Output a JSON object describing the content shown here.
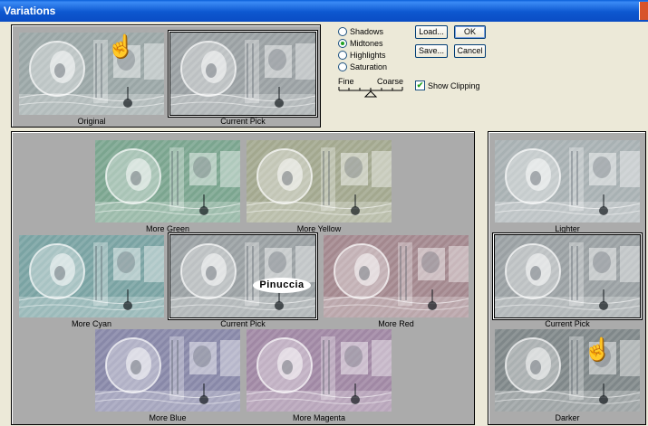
{
  "window": {
    "title": "Variations"
  },
  "tone_options": [
    {
      "label": "Shadows",
      "selected": false
    },
    {
      "label": "Midtones",
      "selected": true
    },
    {
      "label": "Highlights",
      "selected": false
    },
    {
      "label": "Saturation",
      "selected": false
    }
  ],
  "buttons": {
    "load": "Load...",
    "ok": "OK",
    "save": "Save...",
    "cancel": "Cancel"
  },
  "slider": {
    "fine": "Fine",
    "coarse": "Coarse",
    "level": 0.5
  },
  "show_clipping": {
    "label": "Show Clipping",
    "checked": true
  },
  "top_thumbs": {
    "original": "Original",
    "current": "Current Pick"
  },
  "color_thumbs": {
    "more_green": "More Green",
    "more_yellow": "More Yellow",
    "more_cyan": "More Cyan",
    "current": "Current Pick",
    "more_red": "More Red",
    "more_blue": "More Blue",
    "more_magenta": "More Magenta"
  },
  "brightness_thumbs": {
    "lighter": "Lighter",
    "current": "Current Pick",
    "darker": "Darker"
  },
  "watermark": "Pinuccia",
  "tints": {
    "original": "#9aa6a6",
    "current": "#9aa0a3",
    "more_green": "#7ba58f",
    "more_yellow": "#a3a88f",
    "more_cyan": "#7aa3a3",
    "more_red": "#a3888e",
    "more_blue": "#8888a8",
    "more_magenta": "#a088a4",
    "lighter": "#a8b1b3",
    "darker": "#7f8789"
  }
}
